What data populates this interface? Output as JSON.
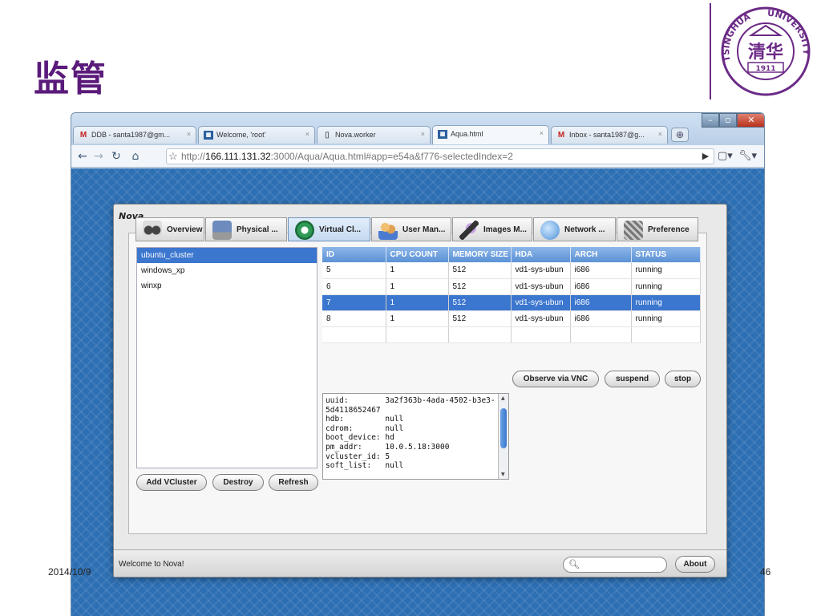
{
  "slide": {
    "title": "监管",
    "date": "2014/10/9",
    "page_number": "46",
    "logo": {
      "text_top": "TSINGHUA",
      "text_right": "UNIVERSITY",
      "center_text": "清华",
      "year": "1911",
      "color": "#6b2a86"
    }
  },
  "browser": {
    "tabs": [
      {
        "icon": "gmail-icon",
        "label": "DDB - santa1987@gm..."
      },
      {
        "icon": "page-favicon",
        "label": "Welcome, 'root'"
      },
      {
        "icon": "document-icon",
        "label": "Nova.worker"
      },
      {
        "icon": "page-favicon",
        "label": "Aqua.html",
        "active": true
      },
      {
        "icon": "gmail-icon",
        "label": "Inbox - santa1987@g..."
      }
    ],
    "url_prefix": "http://",
    "url_host": "166.111.131.32",
    "url_path": ":3000/Aqua/Aqua.html#app=e54a&f776-selectedIndex=2"
  },
  "nova": {
    "title": "Nova",
    "tabs": [
      "Overview",
      "Physical ...",
      "Virtual Cl...",
      "User Man...",
      "Images M...",
      "Network ...",
      "Preference"
    ],
    "active_tab": 2,
    "vclusters": [
      "ubuntu_cluster",
      "windows_xp",
      "winxp"
    ],
    "selected_vcluster": 0,
    "buttons": {
      "add": "Add VCluster",
      "destroy": "Destroy",
      "refresh": "Refresh"
    },
    "table": {
      "columns": [
        "ID",
        "CPU COUNT",
        "MEMORY SIZE",
        "HDA",
        "ARCH",
        "STATUS"
      ],
      "rows": [
        [
          "5",
          "1",
          "512",
          "vd1-sys-ubun",
          "i686",
          "running"
        ],
        [
          "6",
          "1",
          "512",
          "vd1-sys-ubun",
          "i686",
          "running"
        ],
        [
          "7",
          "1",
          "512",
          "vd1-sys-ubun",
          "i686",
          "running"
        ],
        [
          "8",
          "1",
          "512",
          "vd1-sys-ubun",
          "i686",
          "running"
        ]
      ],
      "selected_row": 2
    },
    "actions": {
      "vnc": "Observe via VNC",
      "suspend": "suspend",
      "stop": "stop"
    },
    "detail_text": "uuid:        3a2f363b-4ada-4502-b3e3-5d4118652467\nhdb:         null\ncdrom:       null\nboot_device: hd\npm_addr:     10.0.5.18:3000\nvcluster_id: 5\nsoft_list:   null",
    "status_text": "Welcome to Nova!",
    "search_value": "",
    "about_label": "About"
  }
}
